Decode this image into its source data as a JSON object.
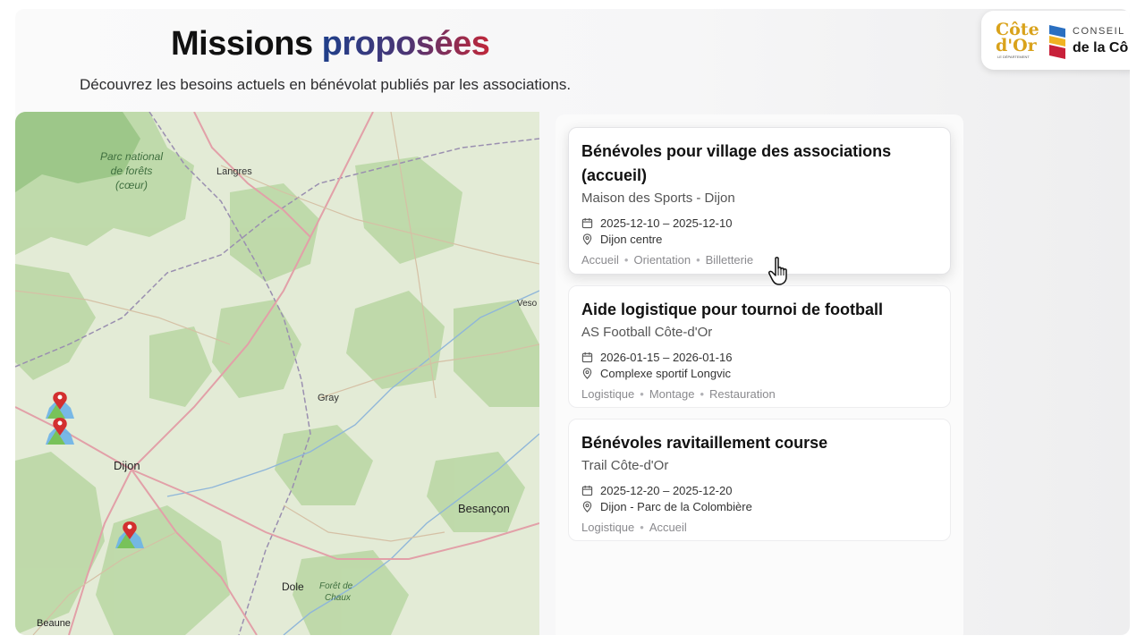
{
  "header": {
    "title_part1": "Missions",
    "title_part2": "proposées",
    "subtitle": "Découvrez les besoins actuels en bénévolat publiés par les associations."
  },
  "logo": {
    "wordmark_line1": "Côte",
    "wordmark_line2": "d'Or",
    "tagline": "LE DÉPARTEMENT",
    "conseil": "CONSEIL",
    "delacote": "de la Cô"
  },
  "map": {
    "labels": {
      "park_line1": "Parc national",
      "park_line2": "de forêts",
      "park_line3": "(cœur)",
      "langres": "Langres",
      "vesoul": "Veso",
      "gray": "Gray",
      "dijon": "Dijon",
      "besancon": "Besançon",
      "dole": "Dole",
      "foret1": "Forêt de",
      "foret2": "Chaux",
      "beaune": "Beaune"
    },
    "marker_count": 3
  },
  "missions": [
    {
      "title": "Bénévoles pour village des associations (accueil)",
      "org": "Maison des Sports - Dijon",
      "dates": "2025-12-10 – 2025-12-10",
      "location": "Dijon centre",
      "tags": [
        "Accueil",
        "Orientation",
        "Billetterie"
      ]
    },
    {
      "title": "Aide logistique pour tournoi de football",
      "org": "AS Football Côte-d'Or",
      "dates": "2026-01-15 – 2026-01-16",
      "location": "Complexe sportif Longvic",
      "tags": [
        "Logistique",
        "Montage",
        "Restauration"
      ]
    },
    {
      "title": "Bénévoles ravitaillement course",
      "org": "Trail Côte-d'Or",
      "dates": "2025-12-20 – 2025-12-20",
      "location": "Dijon - Parc de la Colombière",
      "tags": [
        "Logistique",
        "Accueil"
      ]
    }
  ],
  "colors": {
    "accent_blue": "#1f3f8a",
    "accent_red": "#c0273a",
    "marker_red": "#d32f2f",
    "logo_gold": "#d9a21b"
  },
  "icons": {
    "calendar": "calendar-icon",
    "location": "map-pin-icon",
    "marker": "map-marker-icon",
    "cursor": "hand-pointer-icon"
  }
}
